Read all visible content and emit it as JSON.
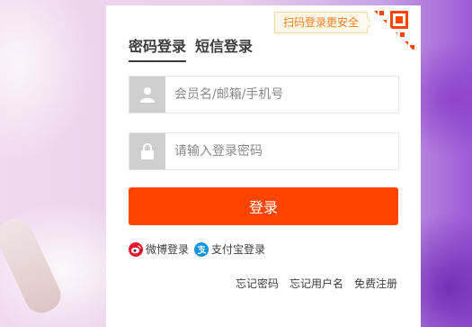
{
  "qr_tip": "扫码登录更安全",
  "tabs": [
    {
      "label": "密码登录"
    },
    {
      "label": "短信登录"
    }
  ],
  "username": {
    "placeholder": "会员名/邮箱/手机号",
    "value": ""
  },
  "password": {
    "placeholder": "请输入登录密码",
    "value": ""
  },
  "login_button": "登录",
  "alt_login": {
    "weibo": "微博登录",
    "alipay": "支付宝登录"
  },
  "links": {
    "forgot_password": "忘记密码",
    "forgot_username": "忘记用户名",
    "register": "免费注册"
  },
  "colors": {
    "accent": "#ff4400",
    "qr_orange": "#ef7d1d",
    "weibo": "#e6162d",
    "alipay": "#1296db"
  }
}
